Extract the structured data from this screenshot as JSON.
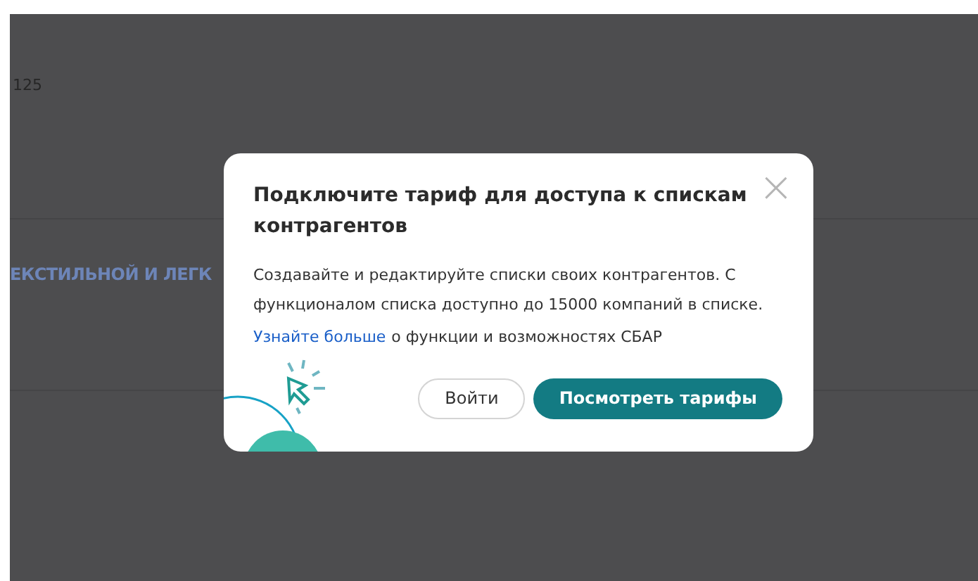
{
  "background": {
    "value": "125",
    "row_title": "ЕКСТИЛЬНОЙ И ЛЕГК"
  },
  "dialog": {
    "title": "Подключите тариф для доступа к спискам контрагентов",
    "close": "×",
    "description": "Создавайте и редактируйте списки своих контрагентов. С функционалом списка доступно до 15000 компаний в списке.",
    "link": "Узнайте больше",
    "link_suffix": "о функции и возможностях СБАР",
    "buttons": [
      {
        "label": "Войти",
        "kind": "secondary"
      },
      {
        "label": "Посмотреть тарифы",
        "kind": "primary"
      }
    ]
  }
}
